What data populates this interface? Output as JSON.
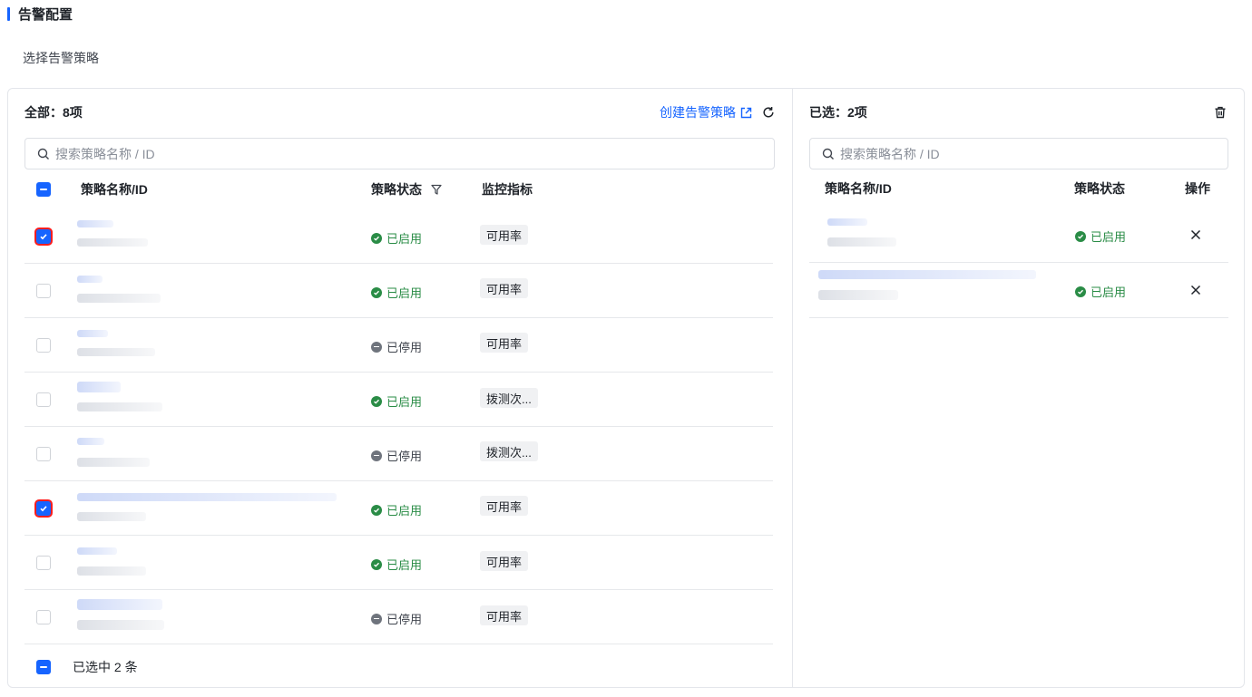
{
  "section": {
    "title": "告警配置"
  },
  "field_label": "选择告警策略",
  "left": {
    "count_label": "全部：8项",
    "create_link": "创建告警策略",
    "search_placeholder": "搜索策略名称 / ID",
    "columns": {
      "name": "策略名称/ID",
      "status": "策略状态",
      "metric": "监控指标"
    },
    "rows": [
      {
        "checked": true,
        "status": "已启用",
        "enabled": true,
        "metric": "可用率"
      },
      {
        "checked": false,
        "status": "已启用",
        "enabled": true,
        "metric": "可用率"
      },
      {
        "checked": false,
        "status": "已停用",
        "enabled": false,
        "metric": "可用率"
      },
      {
        "checked": false,
        "status": "已启用",
        "enabled": true,
        "metric": "拨测次..."
      },
      {
        "checked": false,
        "status": "已停用",
        "enabled": false,
        "metric": "拨测次..."
      },
      {
        "checked": true,
        "status": "已启用",
        "enabled": true,
        "metric": "可用率"
      },
      {
        "checked": false,
        "status": "已启用",
        "enabled": true,
        "metric": "可用率"
      },
      {
        "checked": false,
        "status": "已停用",
        "enabled": false,
        "metric": "可用率"
      }
    ],
    "footer": "已选中 2 条"
  },
  "right": {
    "count_label": "已选：2项",
    "search_placeholder": "搜索策略名称 / ID",
    "columns": {
      "name": "策略名称/ID",
      "status": "策略状态",
      "action": "操作"
    },
    "rows": [
      {
        "status": "已启用",
        "enabled": true
      },
      {
        "status": "已启用",
        "enabled": true
      }
    ]
  },
  "colors": {
    "primary": "#1664ff",
    "enabled": "#2a8c46",
    "disabled": "#6f747d",
    "highlight": "#ff1f1f"
  },
  "icons": [
    "external-link-icon",
    "refresh-icon",
    "trash-icon",
    "search-icon",
    "filter-icon",
    "check-icon",
    "minus-icon",
    "close-icon"
  ]
}
